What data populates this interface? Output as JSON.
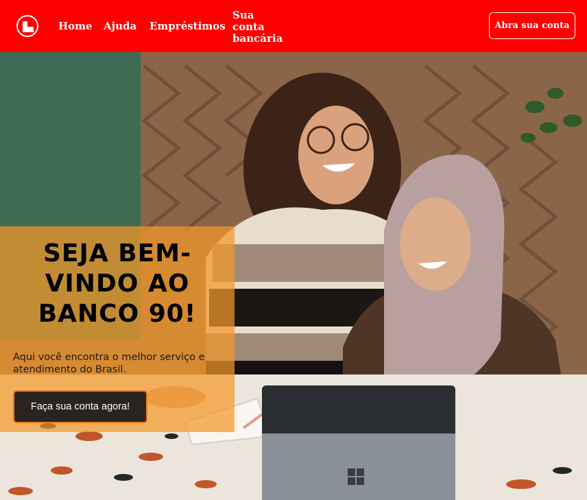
{
  "header": {
    "logo_icon": "bank-logo-icon",
    "nav": [
      {
        "label": "Home"
      },
      {
        "label": "Ajuda"
      },
      {
        "label": "Empréstimos"
      },
      {
        "label": "Sua conta bancária"
      }
    ],
    "open_account_label": "Abra sua conta"
  },
  "hero": {
    "title": "SEJA BEM-VINDO AO BANCO 90!",
    "subtitle": "Aqui você encontra o melhor serviço e atendimento do Brasil.",
    "cta_label": "Faça sua conta agora!"
  },
  "colors": {
    "header_bg": "#ff0000",
    "overlay": "#f49828",
    "cta_bg": "#2b2321",
    "cta_border": "#e87a1e"
  }
}
